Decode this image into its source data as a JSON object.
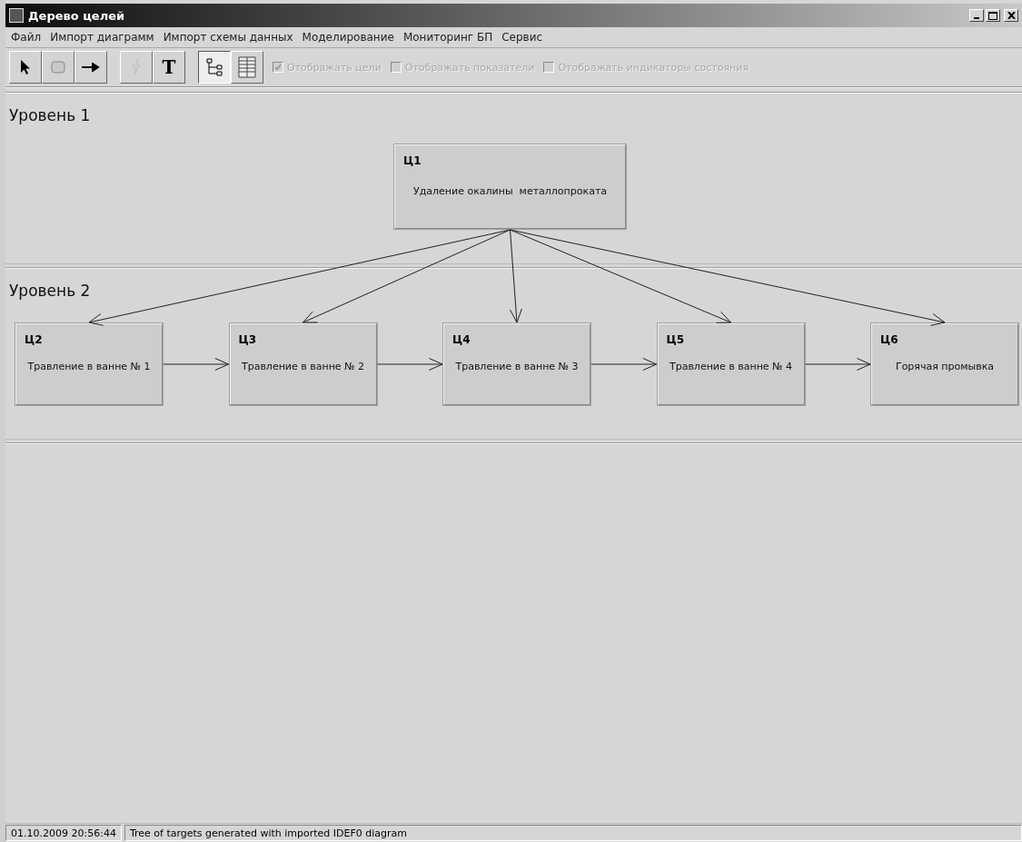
{
  "window": {
    "title": "Дерево целей"
  },
  "menu": [
    "Файл",
    "Импорт диаграмм",
    "Импорт схемы данных",
    "Моделирование",
    "Мониторинг БП",
    "Сервис"
  ],
  "toolbar": [
    {
      "kind": "pointer",
      "disabled": false,
      "selected": false
    },
    {
      "kind": "rectangle",
      "disabled": false,
      "selected": false
    },
    {
      "kind": "arrow",
      "disabled": false,
      "selected": false
    },
    {
      "kind": "lightning",
      "disabled": true,
      "selected": false
    },
    {
      "kind": "text",
      "glyph": "T",
      "disabled": false,
      "selected": false
    },
    {
      "kind": "tree",
      "disabled": false,
      "selected": true
    },
    {
      "kind": "table",
      "disabled": false,
      "selected": false
    }
  ],
  "checkboxes": [
    {
      "label": "Отображать цели",
      "checked": true,
      "disabled": true
    },
    {
      "label": "Отображать показатели",
      "checked": false,
      "disabled": true
    },
    {
      "label": "Отображать индикаторы состояния",
      "checked": false,
      "disabled": true
    }
  ],
  "levels": [
    {
      "label": "Уровень 1",
      "goals": [
        {
          "code": "Ц1",
          "text": "Удаление окалины  металлопроката",
          "arrow_from_parent": false,
          "arrow_to_next": false
        }
      ]
    },
    {
      "label": "Уровень 2",
      "goals": [
        {
          "code": "Ц2",
          "text": "Травление в ванне № 1",
          "arrow_from_parent": true,
          "arrow_to_next": true
        },
        {
          "code": "Ц3",
          "text": "Травление в ванне № 2",
          "arrow_from_parent": true,
          "arrow_to_next": true
        },
        {
          "code": "Ц4",
          "text": "Травление в ванне № 3",
          "arrow_from_parent": true,
          "arrow_to_next": true
        },
        {
          "code": "Ц5",
          "text": "Травление в ванне № 4",
          "arrow_from_parent": true,
          "arrow_to_next": true
        },
        {
          "code": "Ц6",
          "text": "Горячая промывка",
          "arrow_from_parent": true,
          "arrow_to_next": false
        }
      ]
    }
  ],
  "status_bar": {
    "timestamp": "01.10.2009 20:56:44",
    "message": "Tree of targets generated with imported IDEF0 diagram"
  }
}
